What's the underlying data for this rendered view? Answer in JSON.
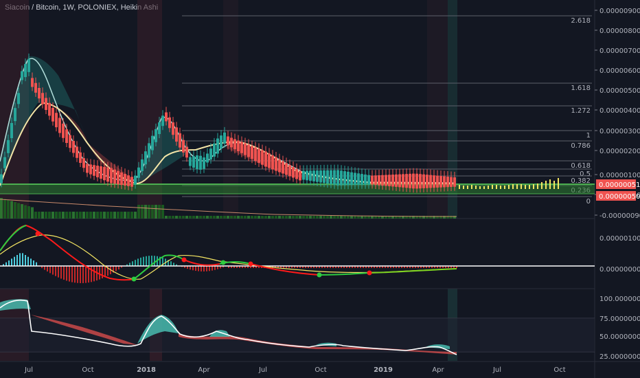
{
  "header": {
    "title": "Siacoin / Bitcoin, 1W, POLONIEX, Heikin Ashi"
  },
  "price_axis": {
    "ticks": [
      "0.00000900",
      "0.00000800",
      "0.00000700",
      "0.00000600",
      "0.00000500",
      "0.00000400",
      "0.00000300",
      "0.00000200",
      "0.00000100",
      "0.00000000",
      "-0.00000090"
    ],
    "current_tag": "0.00000051",
    "second_tag": "0.00000050"
  },
  "fib_levels": [
    "2.618",
    "1.618",
    "1.272",
    "1",
    "0.786",
    "0.618",
    "0.5",
    "0.382",
    "0.236",
    "0"
  ],
  "macd_axis": {
    "ticks": [
      "0.00000100",
      "0.00000000"
    ]
  },
  "rsi_axis": {
    "ticks": [
      "100.00000000",
      "75.00000000",
      "50.00000000",
      "25.00000000"
    ]
  },
  "time_axis": {
    "labels": [
      "Jul",
      "Oct",
      "2018",
      "Apr",
      "Jul",
      "Oct",
      "2019",
      "Apr",
      "Jul",
      "Oct"
    ]
  },
  "colors": {
    "background": "#131722",
    "bull": "#26a69a",
    "bear": "#ef5350",
    "yellow": "#f5e663",
    "green_band": "#2e7d32",
    "price_tag": "#ef5350"
  }
}
